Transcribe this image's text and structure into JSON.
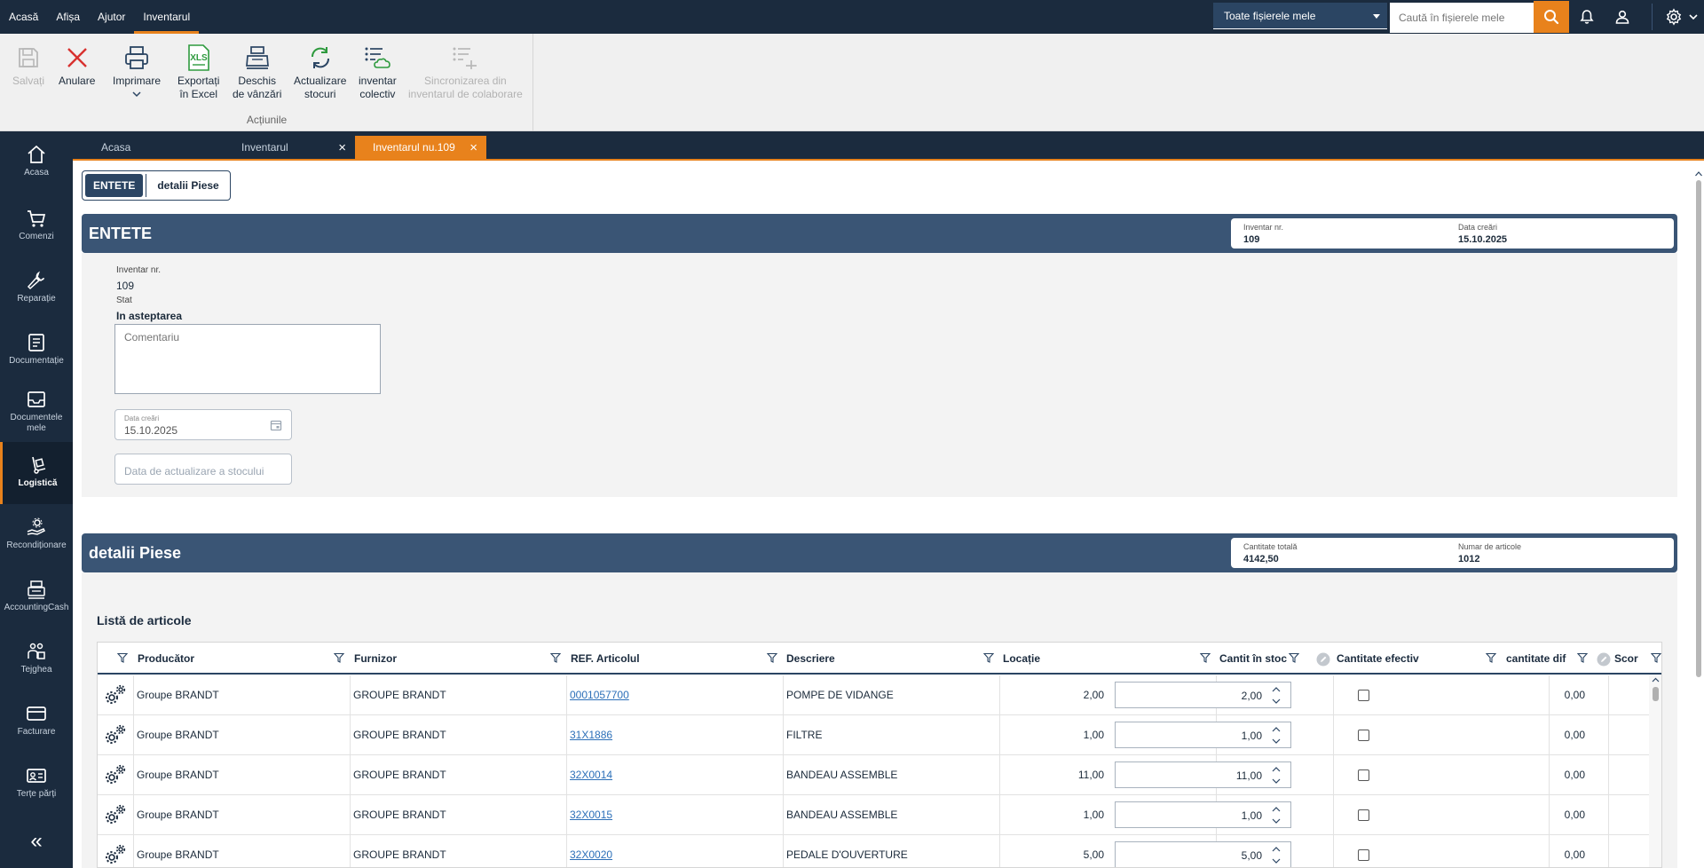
{
  "menu": {
    "items": [
      "Acasă",
      "Afișa",
      "Ajutor",
      "Inventarul"
    ],
    "active_index": 3
  },
  "topbar": {
    "files_select": "Toate fișierele mele",
    "search_placeholder": "Caută în fișierele mele",
    "icons": [
      "search-icon",
      "bell-icon",
      "user-icon",
      "gear-icon",
      "chevron-down-icon"
    ]
  },
  "ribbon": {
    "buttons": {
      "save": "Salvați",
      "cancel": "Anulare",
      "print": "Imprimare",
      "export_excel": "Exportați\nîn Excel",
      "open_sales": "Deschis\nde vânzări",
      "update_stock": "Actualizare\nstocuri",
      "collective_inventory": "inventar\ncolectiv",
      "sync": "Sincronizarea din\ninventarul de colaborare"
    },
    "xls_text": "XLS",
    "group_label": "Acțiunile"
  },
  "leftnav": {
    "items": [
      "Acasa",
      "Comenzi",
      "Reparație",
      "Documentație",
      "Documentele\nmele",
      "Logistică",
      "Recondiționare",
      "AccountingCash",
      "Tejghea",
      "Facturare",
      "Terțe părți"
    ],
    "active_index": 5,
    "collapse_glyph": "«"
  },
  "tabs": [
    "Acasa",
    "Inventarul",
    "Inventarul nu.109"
  ],
  "segments": [
    "ENTETE",
    "detalii Piese"
  ],
  "header_section": {
    "title": "ENTETE",
    "inventory_nr_label": "Inventar nr.",
    "inventory_nr": "109",
    "created_label": "Data creări",
    "created": "15.10.2025"
  },
  "form": {
    "inventory_nr_label": "Inventar nr.",
    "inventory_nr": "109",
    "status_label": "Stat",
    "status": "In asteptarea",
    "comment_placeholder": "Comentariu",
    "date_label": "Data creări",
    "date_value": "15.10.2025",
    "stock_update_placeholder": "Data de actualizare a stocului"
  },
  "parts_section": {
    "title": "detalii Piese",
    "total_qty_label": "Cantitate totală",
    "total_qty": "4142,50",
    "items_count_label": "Numar de articole",
    "items_count": "1012"
  },
  "list": {
    "title": "Listă de articole",
    "columns": [
      "Producător",
      "Furnizor",
      "REF. Articolul",
      "Descriere",
      "Locație",
      "Cantit în stoc",
      "Cantitate efectiv",
      "cantitate dif",
      "Scor"
    ],
    "rows": [
      {
        "producer": "Groupe BRANDT",
        "supplier": "GROUPE BRANDT",
        "ref": "0001057700",
        "desc": "POMPE DE VIDANGE",
        "location": "",
        "stock": "2,00",
        "actual": "2,00",
        "diff": "0,00"
      },
      {
        "producer": "Groupe BRANDT",
        "supplier": "GROUPE BRANDT",
        "ref": "31X1886",
        "desc": "FILTRE",
        "location": "",
        "stock": "1,00",
        "actual": "1,00",
        "diff": "0,00"
      },
      {
        "producer": "Groupe BRANDT",
        "supplier": "GROUPE BRANDT",
        "ref": "32X0014",
        "desc": "BANDEAU ASSEMBLE",
        "location": "",
        "stock": "11,00",
        "actual": "11,00",
        "diff": "0,00"
      },
      {
        "producer": "Groupe BRANDT",
        "supplier": "GROUPE BRANDT",
        "ref": "32X0015",
        "desc": "BANDEAU ASSEMBLE",
        "location": "",
        "stock": "1,00",
        "actual": "1,00",
        "diff": "0,00"
      },
      {
        "producer": "Groupe BRANDT",
        "supplier": "GROUPE BRANDT",
        "ref": "32X0020",
        "desc": "PEDALE D'OUVERTURE",
        "location": "",
        "stock": "5,00",
        "actual": "5,00",
        "diff": "0,00"
      }
    ]
  },
  "colors": {
    "navy": "#1b2b3e",
    "section_blue": "#3a5575",
    "accent_orange": "#e8821c",
    "link_blue": "#2c6fb8"
  }
}
